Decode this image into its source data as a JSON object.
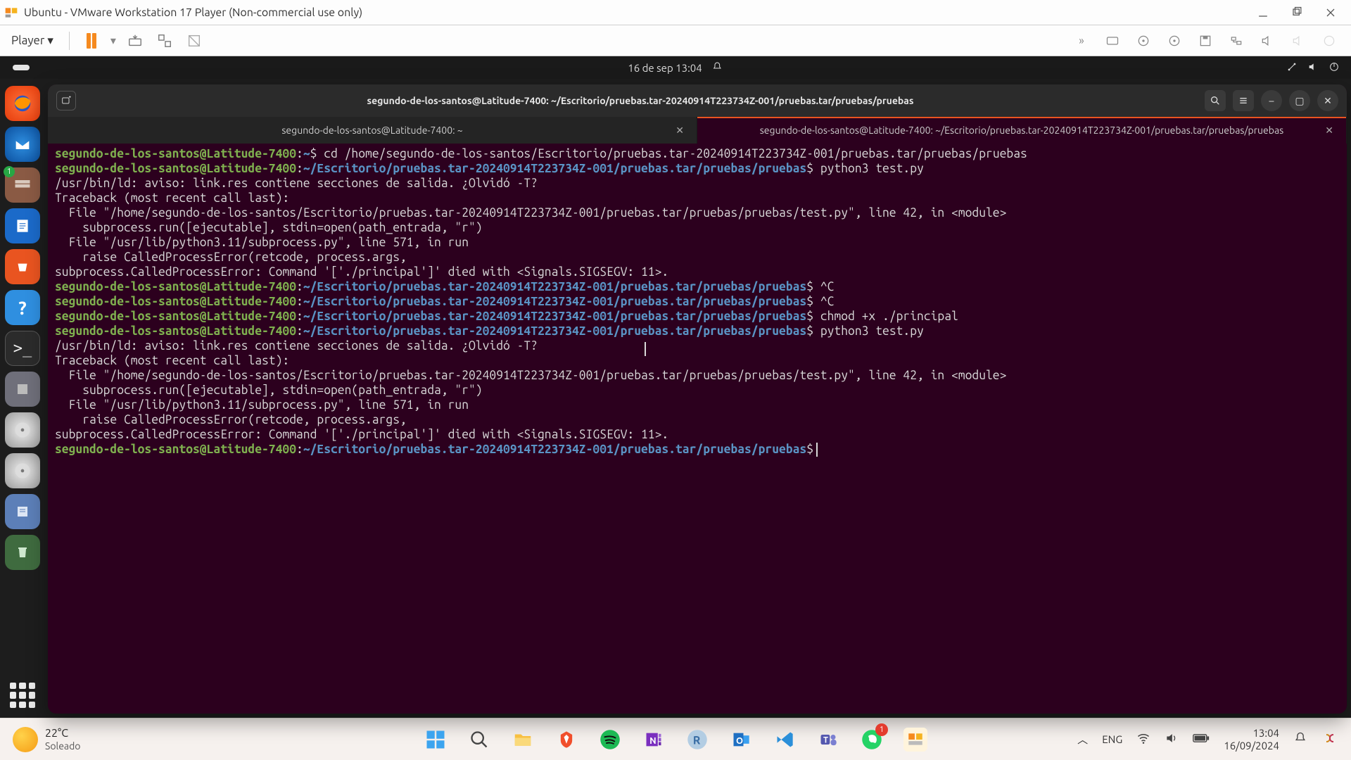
{
  "vmware": {
    "title": "Ubuntu  - VMware Workstation 17 Player (Non-commercial use only)",
    "player_menu": "Player"
  },
  "ubuntu_panel": {
    "datetime": "16 de sep  13:04"
  },
  "dock": {
    "files_badge": "1"
  },
  "terminal": {
    "window_title": "segundo-de-los-santos@Latitude-7400: ~/Escritorio/pruebas.tar-20240914T223734Z-001/pruebas.tar/pruebas/pruebas",
    "tab1": "segundo-de-los-santos@Latitude-7400: ~",
    "tab2": "segundo-de-los-santos@Latitude-7400: ~/Escritorio/pruebas.tar-20240914T223734Z-001/pruebas.tar/pruebas/pruebas",
    "prompt_user": "segundo-de-los-santos@Latitude-7400",
    "prompt_colon": ":",
    "home_path_short": "~",
    "long_path": "~/Escritorio/pruebas.tar-20240914T223734Z-001/pruebas.tar/pruebas/pruebas",
    "dollar": "$",
    "lines": {
      "cd_cmd": " cd /home/segundo-de-los-santos/Escritorio/pruebas.tar-20240914T223734Z-001/pruebas.tar/pruebas/pruebas",
      "run1": " python3 test.py",
      "ld_warn": "/usr/bin/ld: aviso: link.res contiene secciones de salida. ¿Olvidó -T?",
      "tb": "Traceback (most recent call last):",
      "f1": "  File \"/home/segundo-de-los-santos/Escritorio/pruebas.tar-20240914T223734Z-001/pruebas.tar/pruebas/pruebas/test.py\", line 42, in <module>",
      "f1b": "    subprocess.run([ejecutable], stdin=open(path_entrada, \"r\")",
      "f2": "  File \"/usr/lib/python3.11/subprocess.py\", line 571, in run",
      "f2b": "    raise CalledProcessError(retcode, process.args,",
      "err": "subprocess.CalledProcessError: Command '['./principal']' died with <Signals.SIGSEGV: 11>.",
      "ctrlc": " ^C",
      "chmod": " chmod +x ./principal",
      "run2": " python3 test.py"
    }
  },
  "windows": {
    "weather_temp": "22°C",
    "weather_desc": "Soleado",
    "lang": "ENG",
    "time": "13:04",
    "date": "16/09/2024",
    "whatsapp_badge": "1"
  }
}
